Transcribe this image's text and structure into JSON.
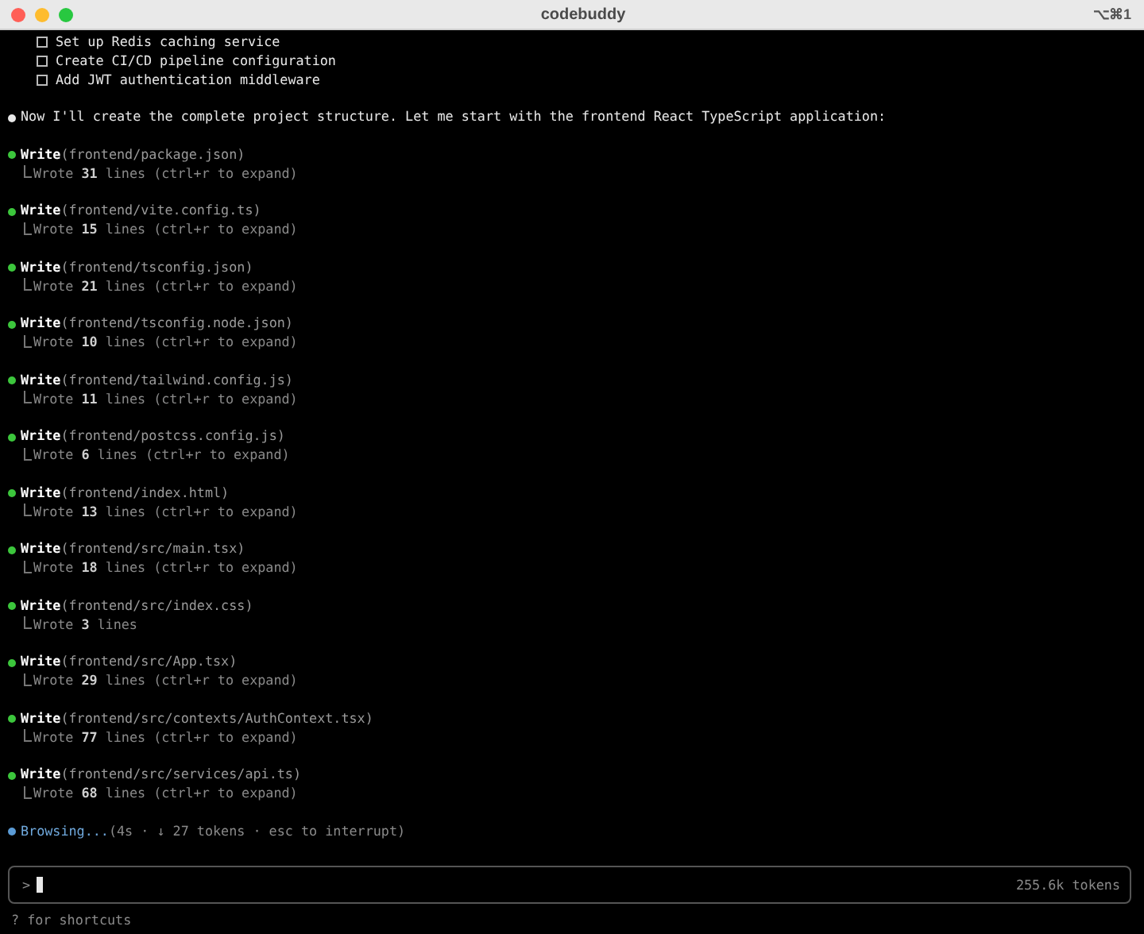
{
  "window": {
    "title": "codebuddy",
    "shortcut": "⌥⌘1"
  },
  "todos": [
    {
      "text": "Set up Redis caching service",
      "checked": false
    },
    {
      "text": "Create CI/CD pipeline configuration",
      "checked": false
    },
    {
      "text": "Add JWT authentication middleware",
      "checked": false
    }
  ],
  "message": {
    "text": "Now I'll create the complete project structure. Let me start with the frontend React TypeScript application:"
  },
  "tool_calls": [
    {
      "tool": "Write",
      "argument": "(frontend/package.json)",
      "completed": true,
      "result": "Wrote",
      "count": "31",
      "detail": "lines (ctrl+r to expand)"
    },
    {
      "tool": "Write",
      "argument": "(frontend/vite.config.ts)",
      "completed": true,
      "result": "Wrote",
      "count": "15",
      "detail": "lines (ctrl+r to expand)"
    },
    {
      "tool": "Write",
      "argument": "(frontend/tsconfig.json)",
      "completed": true,
      "result": "Wrote",
      "count": "21",
      "detail": "lines (ctrl+r to expand)"
    },
    {
      "tool": "Write",
      "argument": "(frontend/tsconfig.node.json)",
      "completed": true,
      "result": "Wrote",
      "count": "10",
      "detail": "lines (ctrl+r to expand)"
    },
    {
      "tool": "Write",
      "argument": "(frontend/tailwind.config.js)",
      "completed": true,
      "result": "Wrote",
      "count": "11",
      "detail": "lines (ctrl+r to expand)"
    },
    {
      "tool": "Write",
      "argument": "(frontend/postcss.config.js)",
      "completed": true,
      "result": "Wrote",
      "count": "6",
      "detail": "lines (ctrl+r to expand)"
    },
    {
      "tool": "Write",
      "argument": "(frontend/index.html)",
      "completed": true,
      "result": "Wrote",
      "count": "13",
      "detail": "lines (ctrl+r to expand)"
    },
    {
      "tool": "Write",
      "argument": "(frontend/src/main.tsx)",
      "completed": true,
      "result": "Wrote",
      "count": "18",
      "detail": "lines (ctrl+r to expand)"
    },
    {
      "tool": "Write",
      "argument": "(frontend/src/index.css)",
      "completed": true,
      "result": "Wrote",
      "count": "3",
      "detail": "lines"
    },
    {
      "tool": "Write",
      "argument": "(frontend/src/App.tsx)",
      "completed": true,
      "result": "Wrote",
      "count": "29",
      "detail": "lines (ctrl+r to expand)"
    },
    {
      "tool": "Write",
      "argument": "(frontend/src/contexts/AuthContext.tsx)",
      "completed": true,
      "result": "Wrote",
      "count": "77",
      "detail": "lines (ctrl+r to expand)"
    },
    {
      "tool": "Write",
      "argument": "(frontend/src/services/api.ts)",
      "completed": true,
      "result": "Wrote",
      "count": "68",
      "detail": "lines (ctrl+r to expand)"
    }
  ],
  "activity": {
    "verb": "Browsing...",
    "detail": "(4s · ↓ 27 tokens · esc to interrupt)"
  },
  "input": {
    "prompt": ">",
    "token_count": "255.6k tokens"
  },
  "hint": "? for shortcuts"
}
